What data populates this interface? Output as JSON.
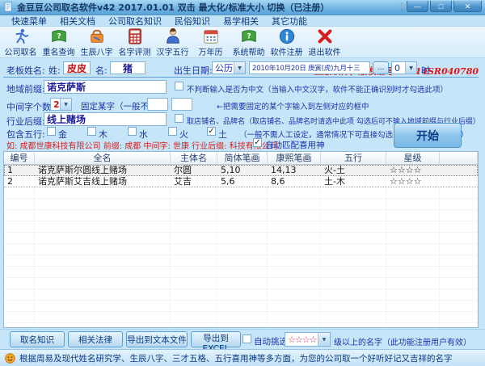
{
  "colors": {
    "accent_blue": "#5aa3d8",
    "license_red": "#e01818",
    "value_red": "#cc1111",
    "value_navy": "#1a1a99",
    "star_red": "#cc3355",
    "label_navy": "#1a35a8"
  },
  "window": {
    "title": "金豆豆公司取名软件v42   2017.01.01  双击 最大化/标准大小 切换（已注册）",
    "controls": {
      "minimize": "—",
      "maximize": "□",
      "close": "✕"
    }
  },
  "menu": {
    "items": [
      "快速菜单",
      "相关文档",
      "公司取名知识",
      "民俗知识",
      "易学相关",
      "其它功能"
    ]
  },
  "toolbar": {
    "buttons": [
      {
        "label": "公司取名",
        "icon": "runner-icon"
      },
      {
        "label": "重名查询",
        "icon": "book-search-icon"
      },
      {
        "label": "生辰八字",
        "icon": "bag-tools-icon"
      },
      {
        "label": "名字评测",
        "icon": "calculator-icon"
      },
      {
        "label": "汉字五行",
        "icon": "person-icon"
      },
      {
        "label": "万年历",
        "icon": "calendar-icon"
      },
      {
        "label": "系统帮助",
        "icon": "help-book-icon"
      },
      {
        "label": "软件注册",
        "icon": "info-icon"
      },
      {
        "label": "退出软件",
        "icon": "exit-icon"
      }
    ],
    "license": "正版软件，版权证号：2014SR040780"
  },
  "form": {
    "boss": {
      "label": "老板姓名:",
      "surname_label": "姓:",
      "surname_value": "皮皮",
      "given_label": "名:",
      "given_value": "猪"
    },
    "birth": {
      "label": "出生日期:",
      "calendar_type": "公历",
      "date_value": "2010年10月20日 庚寅(虎)九月十三",
      "more_label": "...",
      "hour_value": "0",
      "hour_suffix": "时"
    },
    "region": {
      "label": "地域前缀:",
      "value": "诺克萨斯",
      "checkbox_label": "不判断输入是否为中文（当输入中文汉字，软件不能正确识别时才勾选此项）",
      "glyph": ""
    },
    "middle": {
      "label": "中间字个数:",
      "count_value": "2",
      "fixed_label": "固定某字（一般不设定）",
      "box1": "",
      "box2": "",
      "hint": "←把需要固定的某个字输入到左侧对应的框中"
    },
    "industry": {
      "label": "行业后缀:",
      "value": "线上赌场",
      "checkbox_label": "取店铺名、品牌名（取店铺名、品牌名时请选中此项 勾选后可不输入地域前缀与行业后缀）",
      "glyph": ""
    },
    "wuxing": {
      "label": "包含五行:",
      "options": [
        {
          "label": "金",
          "glyph": ""
        },
        {
          "label": "木",
          "glyph": ""
        },
        {
          "label": "水",
          "glyph": ""
        },
        {
          "label": "火",
          "glyph": ""
        },
        {
          "label": "土",
          "glyph": "✓"
        }
      ],
      "hint": "（一般不需人工设定，通常情况下可直接勾选 【自动匹配喜用神】）"
    },
    "example": "如: 成都世康科技有限公司   前缀: 成都   中间字: 世康   行业后缀: 科技有限公司",
    "auto_match": {
      "label": "自动匹配喜用神",
      "glyph": "✓"
    },
    "start_label": "开始"
  },
  "table": {
    "headers": [
      "编号",
      "全名",
      "主体名",
      "简体笔画",
      "康熙笔画",
      "五行",
      "星级"
    ],
    "rows": [
      [
        "1",
        "诺克萨斯尔圆线上赌场",
        "尔圆",
        "5,10",
        "14,13",
        "火-土",
        "☆☆☆☆"
      ],
      [
        "2",
        "诺克萨斯艾吉线上赌场",
        "艾吉",
        "5,6",
        "8,6",
        "土-木",
        "☆☆☆☆"
      ]
    ]
  },
  "footer": {
    "buttons": [
      "取名知识",
      "相关法律",
      "导出到文本文件",
      "导出到EXCEL"
    ],
    "auto_pick": {
      "label": "自动挑选",
      "glyph": "",
      "stars": "☆☆☆☆",
      "suffix": "级以上的名字（此功能注册用户有效）"
    }
  },
  "statusbar": {
    "text": "根据周易及现代姓名研究学、生辰八字、三才五格、五行喜用神等多方面，为您的公司取一个好听好记又吉祥的名字"
  }
}
